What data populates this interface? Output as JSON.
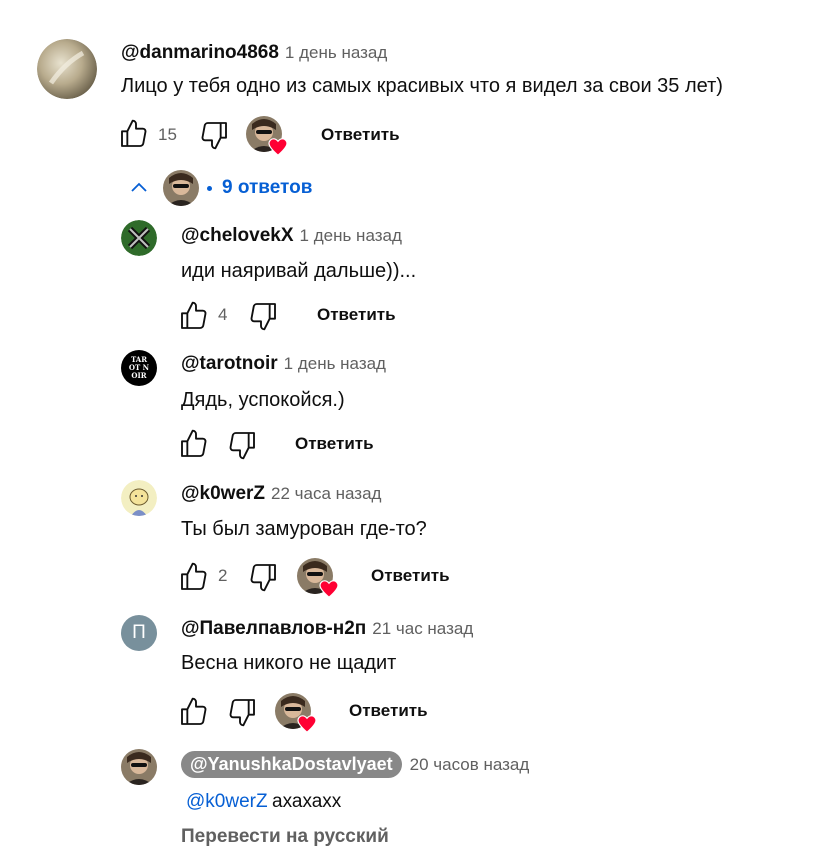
{
  "comment": {
    "author": "@danmarino4868",
    "time": "1 день назад",
    "text": "Лицо у тебя одно из самых красивых что я видел за свои 35 лет)",
    "likes": "15",
    "reply_label": "Ответить"
  },
  "replies_toggle": {
    "label": "9 ответов"
  },
  "replies": [
    {
      "author": "@chelovekX",
      "time": "1 день назад",
      "text": "иди наяривай дальше))...",
      "likes": "4",
      "reply_label": "Ответить"
    },
    {
      "author": "@tarotnoir",
      "time": "1 день назад",
      "text": "Дядь, успокойся.)",
      "likes": "",
      "reply_label": "Ответить",
      "avatar_text": "TAROT NOIR"
    },
    {
      "author": "@k0werZ",
      "time": "22 часа назад",
      "text": "Ты был замурован где-то?",
      "likes": "2",
      "reply_label": "Ответить"
    },
    {
      "author": "@Павелпавлов-н2п",
      "time": "21 час назад",
      "text": "Весна никого не щадит",
      "likes": "",
      "reply_label": "Ответить",
      "avatar_letter": "П"
    },
    {
      "author": "@YanushkaDostavlyaet",
      "time": "20 часов назад",
      "mention": "@k0werZ",
      "text": "ахахахх",
      "translate_label": "Перевести на русский"
    }
  ],
  "colors": {
    "link_blue": "#065fd4",
    "heart_red": "#ff0033",
    "secondary_text": "#606060"
  }
}
